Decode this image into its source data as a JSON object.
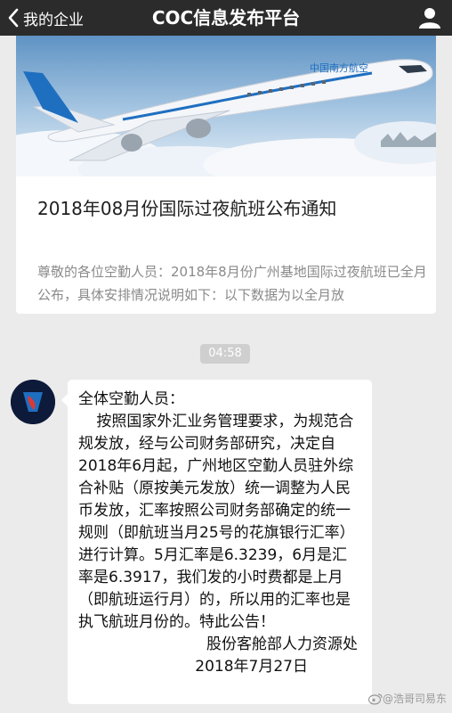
{
  "navbar": {
    "back_label": "我的企业",
    "title": "COC信息发布平台"
  },
  "article": {
    "title": "2018年08月份国际过夜航班公布通知",
    "summary": "尊敬的各位空勤人员：2018年8月份广州基地国际过夜航班已全月公布，具体安排情况说明如下：以下数据为以全月放",
    "plane_livery_text": "中国南方航空"
  },
  "timestamp": "04:58",
  "message": {
    "greeting": "全体空勤人员：",
    "body": "按照国家外汇业务管理要求，为规范合规发放，经与公司财务部研究，决定自2018年6月起，广州地区空勤人员驻外综合补贴（原按美元发放）统一调整为人民币发放，汇率按照公司财务部确定的统一规则（即航班当月25号的花旗银行汇率）进行计算。5月汇率是6.3239，6月是汇率是6.3917，我们发的小时费都是上月（即航班运行月）的，所以用的汇率也是执飞航班月份的。特此公告！",
    "signature": "股份客舱部人力资源处",
    "date": "2018年7月27日"
  },
  "watermark": "@浩哥司易东",
  "colors": {
    "navbar": "#2b2b2b",
    "background": "#ebebeb",
    "summary_text": "#8a8a8a",
    "airline_blue": "#1f6fc0"
  }
}
